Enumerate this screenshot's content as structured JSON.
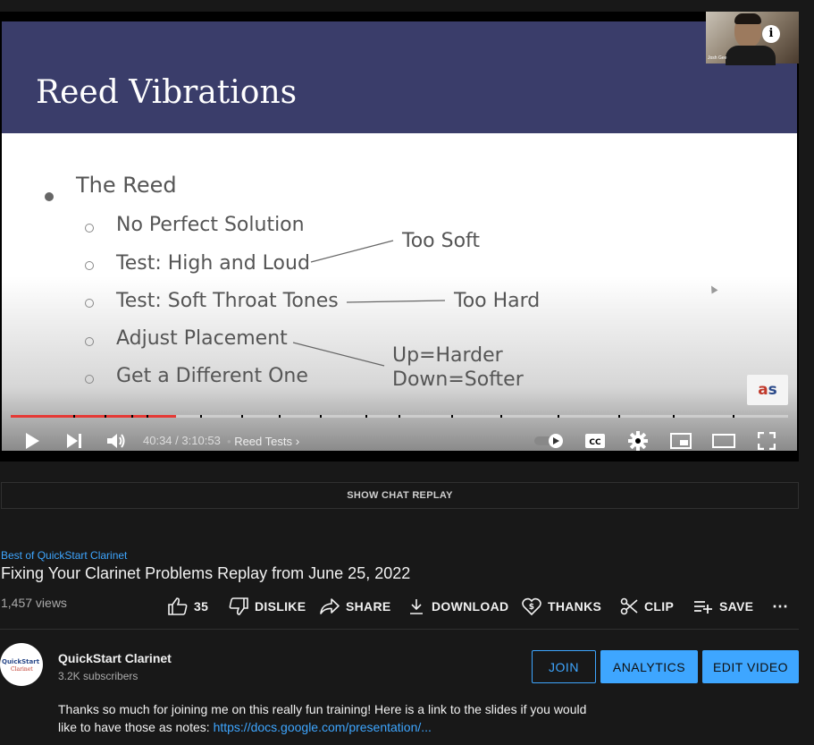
{
  "slide": {
    "title": "Reed Vibrations",
    "main_bullet": "The Reed",
    "sub_bullets": [
      "No Perfect Solution",
      "Test: High and Loud",
      "Test: Soft Throat Tones",
      "Adjust Placement",
      "Get a Different One"
    ],
    "annotations": {
      "too_soft": "Too Soft",
      "too_hard": "Too Hard",
      "up_harder": "Up=Harder",
      "down_softer": "Down=Softer"
    },
    "presenter_label": "Josh Gee"
  },
  "player": {
    "current_time": "40:34",
    "separator": "/",
    "duration": "3:10:53",
    "chapter": "Reed Tests",
    "progress_fraction": 0.2126
  },
  "chat": {
    "label": "SHOW CHAT REPLAY"
  },
  "video": {
    "hashtag": "Best of QuickStart Clarinet",
    "title": "Fixing Your Clarinet Problems Replay from June 25, 2022",
    "views": "1,457 views"
  },
  "actions": {
    "like_count": "35",
    "dislike": "DISLIKE",
    "share": "SHARE",
    "download": "DOWNLOAD",
    "thanks": "THANKS",
    "clip": "CLIP",
    "save": "SAVE"
  },
  "channel": {
    "name": "QuickStart Clarinet",
    "subscribers": "3.2K subscribers",
    "avatar_text_1": "QuickStart",
    "avatar_text_2": "Clarinet",
    "join": "JOIN",
    "analytics": "ANALYTICS",
    "edit_video": "EDIT VIDEO"
  },
  "description": {
    "text": "Thanks so much for joining me on this really fun training! Here is a link to the slides if you would like to have those as notes: ",
    "link": "https://docs.google.com/presentation/..."
  },
  "colors": {
    "background": "#181818",
    "accent_blue": "#3ea6ff",
    "progress_red": "#e53935",
    "slide_header": "#3a3d6a"
  }
}
